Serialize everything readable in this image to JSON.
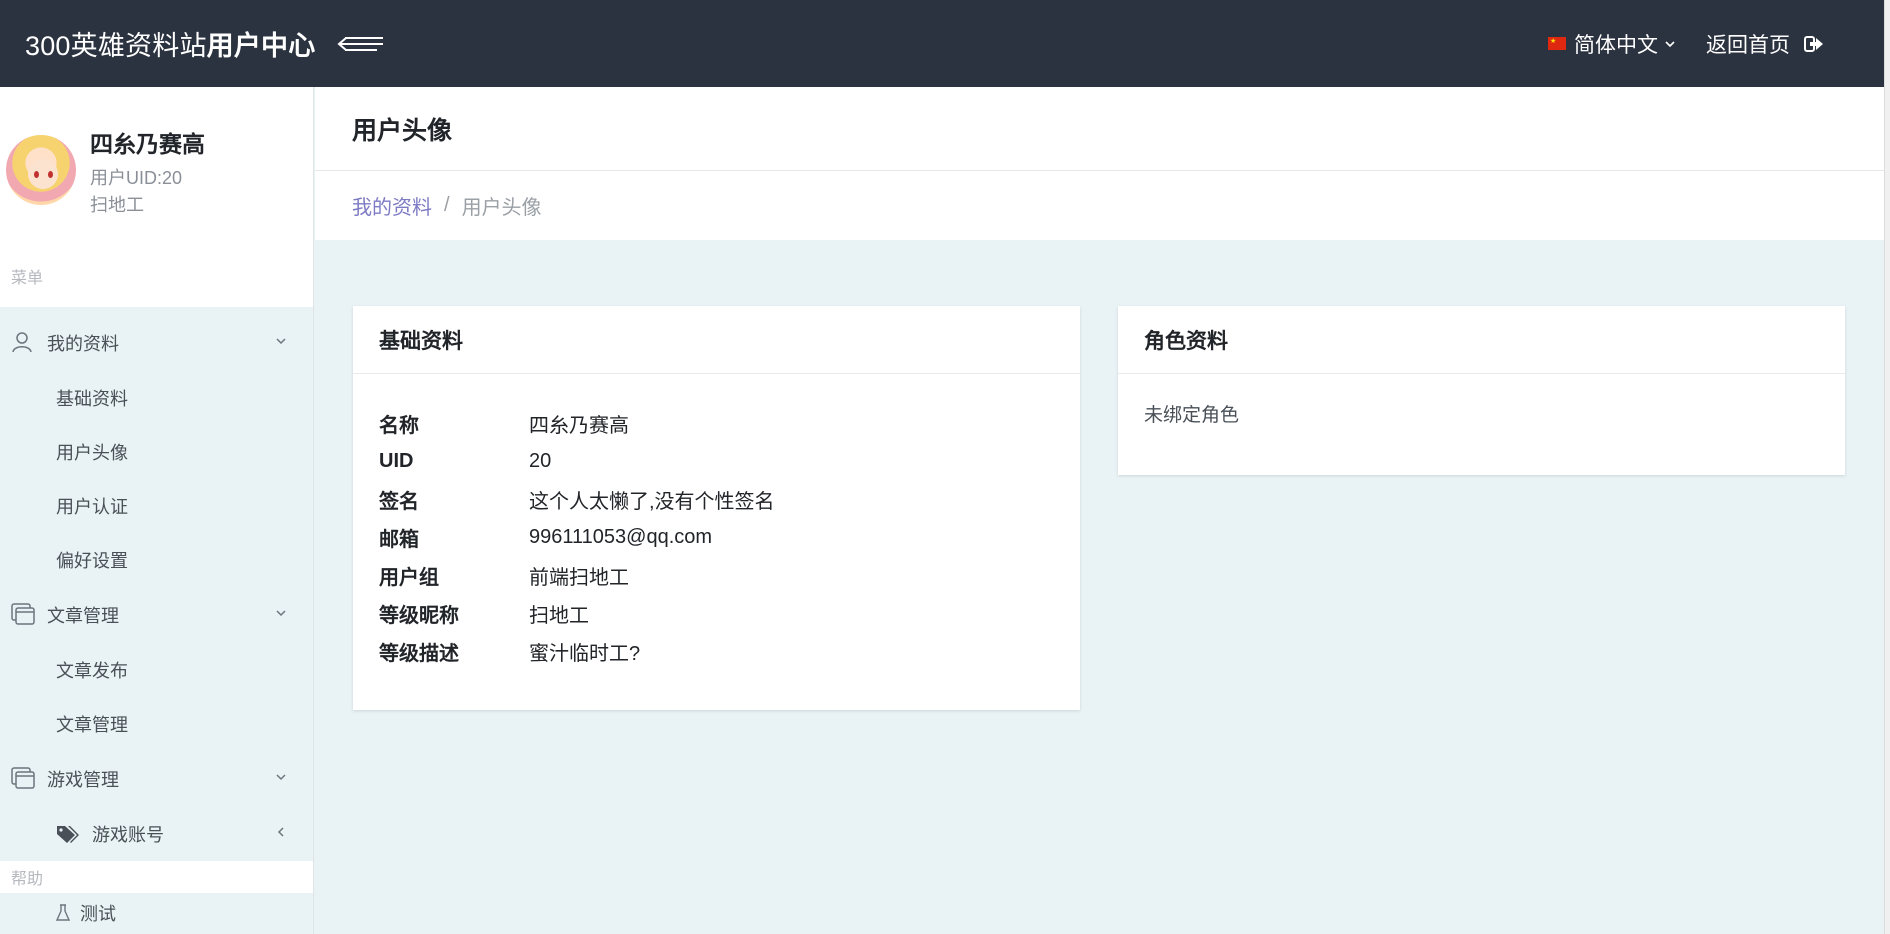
{
  "header": {
    "brand_plain": "300英雄资料站",
    "brand_bold": "用户中心",
    "language": "简体中文",
    "home_link": "返回首页",
    "colors": {
      "topbar": "#2c3340",
      "link": "#7d7bc4",
      "background": "#e9f3f5"
    }
  },
  "user": {
    "name": "四糸乃赛高",
    "uid": "用户UID:20",
    "title": "扫地工"
  },
  "sidebar": {
    "section_label": "菜单",
    "groups": [
      {
        "label": "我的资料",
        "icon": "user-icon",
        "items": [
          {
            "label": "基础资料"
          },
          {
            "label": "用户头像"
          },
          {
            "label": "用户认证"
          },
          {
            "label": "偏好设置"
          }
        ]
      },
      {
        "label": "文章管理",
        "icon": "window-icon",
        "items": [
          {
            "label": "文章发布"
          },
          {
            "label": "文章管理"
          }
        ]
      },
      {
        "label": "游戏管理",
        "icon": "window-icon",
        "items": [
          {
            "label": "游戏账号",
            "icon": "tags-icon"
          }
        ]
      }
    ],
    "help_label": "帮助",
    "help_items": [
      {
        "label": "测试"
      }
    ]
  },
  "main": {
    "page_title": "用户头像",
    "breadcrumb": {
      "parent": "我的资料",
      "current": "用户头像",
      "separator": "/"
    },
    "basic_card": {
      "title": "基础资料",
      "rows": [
        {
          "key": "名称",
          "value": "四糸乃赛高"
        },
        {
          "key": "UID",
          "value": "20"
        },
        {
          "key": "签名",
          "value": "这个人太懒了,没有个性签名"
        },
        {
          "key": "邮箱",
          "value": "996111053@qq.com"
        },
        {
          "key": "用户组",
          "value": "前端扫地工"
        },
        {
          "key": "等级昵称",
          "value": "扫地工"
        },
        {
          "key": "等级描述",
          "value": "蜜汁临时工?"
        }
      ]
    },
    "role_card": {
      "title": "角色资料",
      "empty_text": "未绑定角色"
    }
  }
}
